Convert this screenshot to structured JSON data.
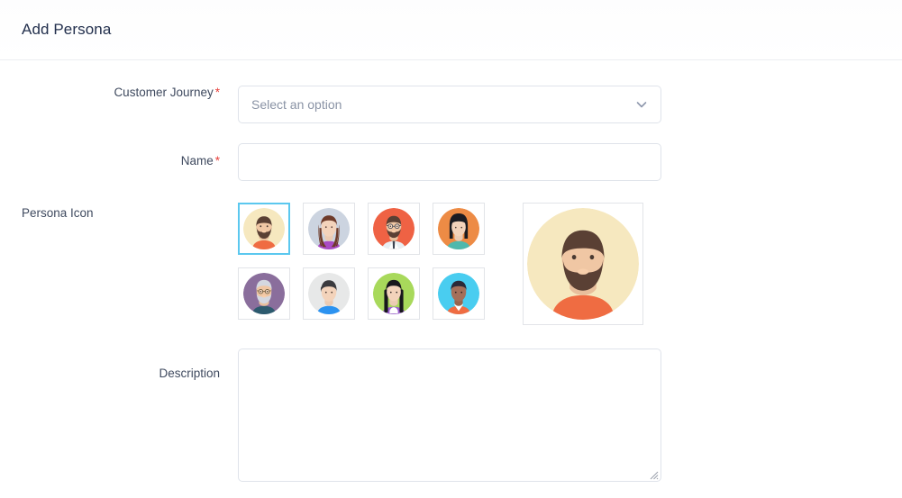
{
  "header": {
    "title": "Add Persona"
  },
  "form": {
    "customer_journey": {
      "label": "Customer Journey",
      "required_marker": "*",
      "placeholder": "Select an option",
      "value": "",
      "chevron_icon": "chevron-down-icon"
    },
    "name": {
      "label": "Name",
      "required_marker": "*",
      "placeholder": "",
      "value": ""
    },
    "persona_icon": {
      "label": "Persona Icon",
      "selected_index": 0,
      "options": [
        {
          "id": "avatar-bearded-man-cream",
          "name": "bearded-man-cream-avatar",
          "bg": "#f6e8bf",
          "skin": "#f0c7a4",
          "hair": "#5a4034",
          "shirt": "#ef6c42",
          "selected": true
        },
        {
          "id": "avatar-long-hair-woman-grey",
          "name": "long-hair-woman-grey-avatar",
          "bg": "#ccd4e0",
          "skin": "#f3d3bb",
          "hair": "#6e3b2a",
          "shirt": "#a94bc4",
          "selected": false
        },
        {
          "id": "avatar-glasses-beard-man-red",
          "name": "glasses-beard-man-red-avatar",
          "bg": "#ef6244",
          "skin": "#f0c7a4",
          "hair": "#5a4034",
          "shirt": "#e8eef2",
          "selected": false
        },
        {
          "id": "avatar-bob-hair-woman-orange",
          "name": "bob-hair-woman-orange-avatar",
          "bg": "#ed8b45",
          "skin": "#f3d3bb",
          "hair": "#1c1c22",
          "shirt": "#4fb8ac",
          "selected": false
        },
        {
          "id": "avatar-grey-beard-man-purple",
          "name": "grey-beard-man-purple-avatar",
          "bg": "#8a6e9c",
          "skin": "#f0c7a4",
          "hair": "#d4d8e0",
          "shirt": "#2c5a6e",
          "selected": false
        },
        {
          "id": "avatar-short-hair-man-grey",
          "name": "short-hair-man-grey-avatar",
          "bg": "#e7e8e8",
          "skin": "#f3d3bb",
          "hair": "#3a3a3e",
          "shirt": "#2b92f0",
          "selected": false
        },
        {
          "id": "avatar-long-black-hair-woman-green",
          "name": "long-black-hair-woman-green-avatar",
          "bg": "#a8d95b",
          "skin": "#f3d3bb",
          "hair": "#17171c",
          "shirt": "#9b5fd0",
          "selected": false
        },
        {
          "id": "avatar-dark-skin-man-cyan",
          "name": "dark-skin-man-cyan-avatar",
          "bg": "#49cdf0",
          "skin": "#a4705a",
          "hair": "#2a2a38",
          "shirt": "#ef6c42",
          "selected": false
        }
      ],
      "preview": {
        "name": "selected-persona-preview",
        "bg": "#f6e8bf",
        "skin": "#f0c7a4",
        "hair": "#5a4034",
        "shirt": "#ef6c42"
      }
    },
    "description": {
      "label": "Description",
      "placeholder": "",
      "value": ""
    }
  },
  "colors": {
    "title": "#23304d",
    "required": "#e8413c",
    "border": "#dfe3ea",
    "selected_border": "#5bc8ef",
    "placeholder": "#8a93a5"
  }
}
